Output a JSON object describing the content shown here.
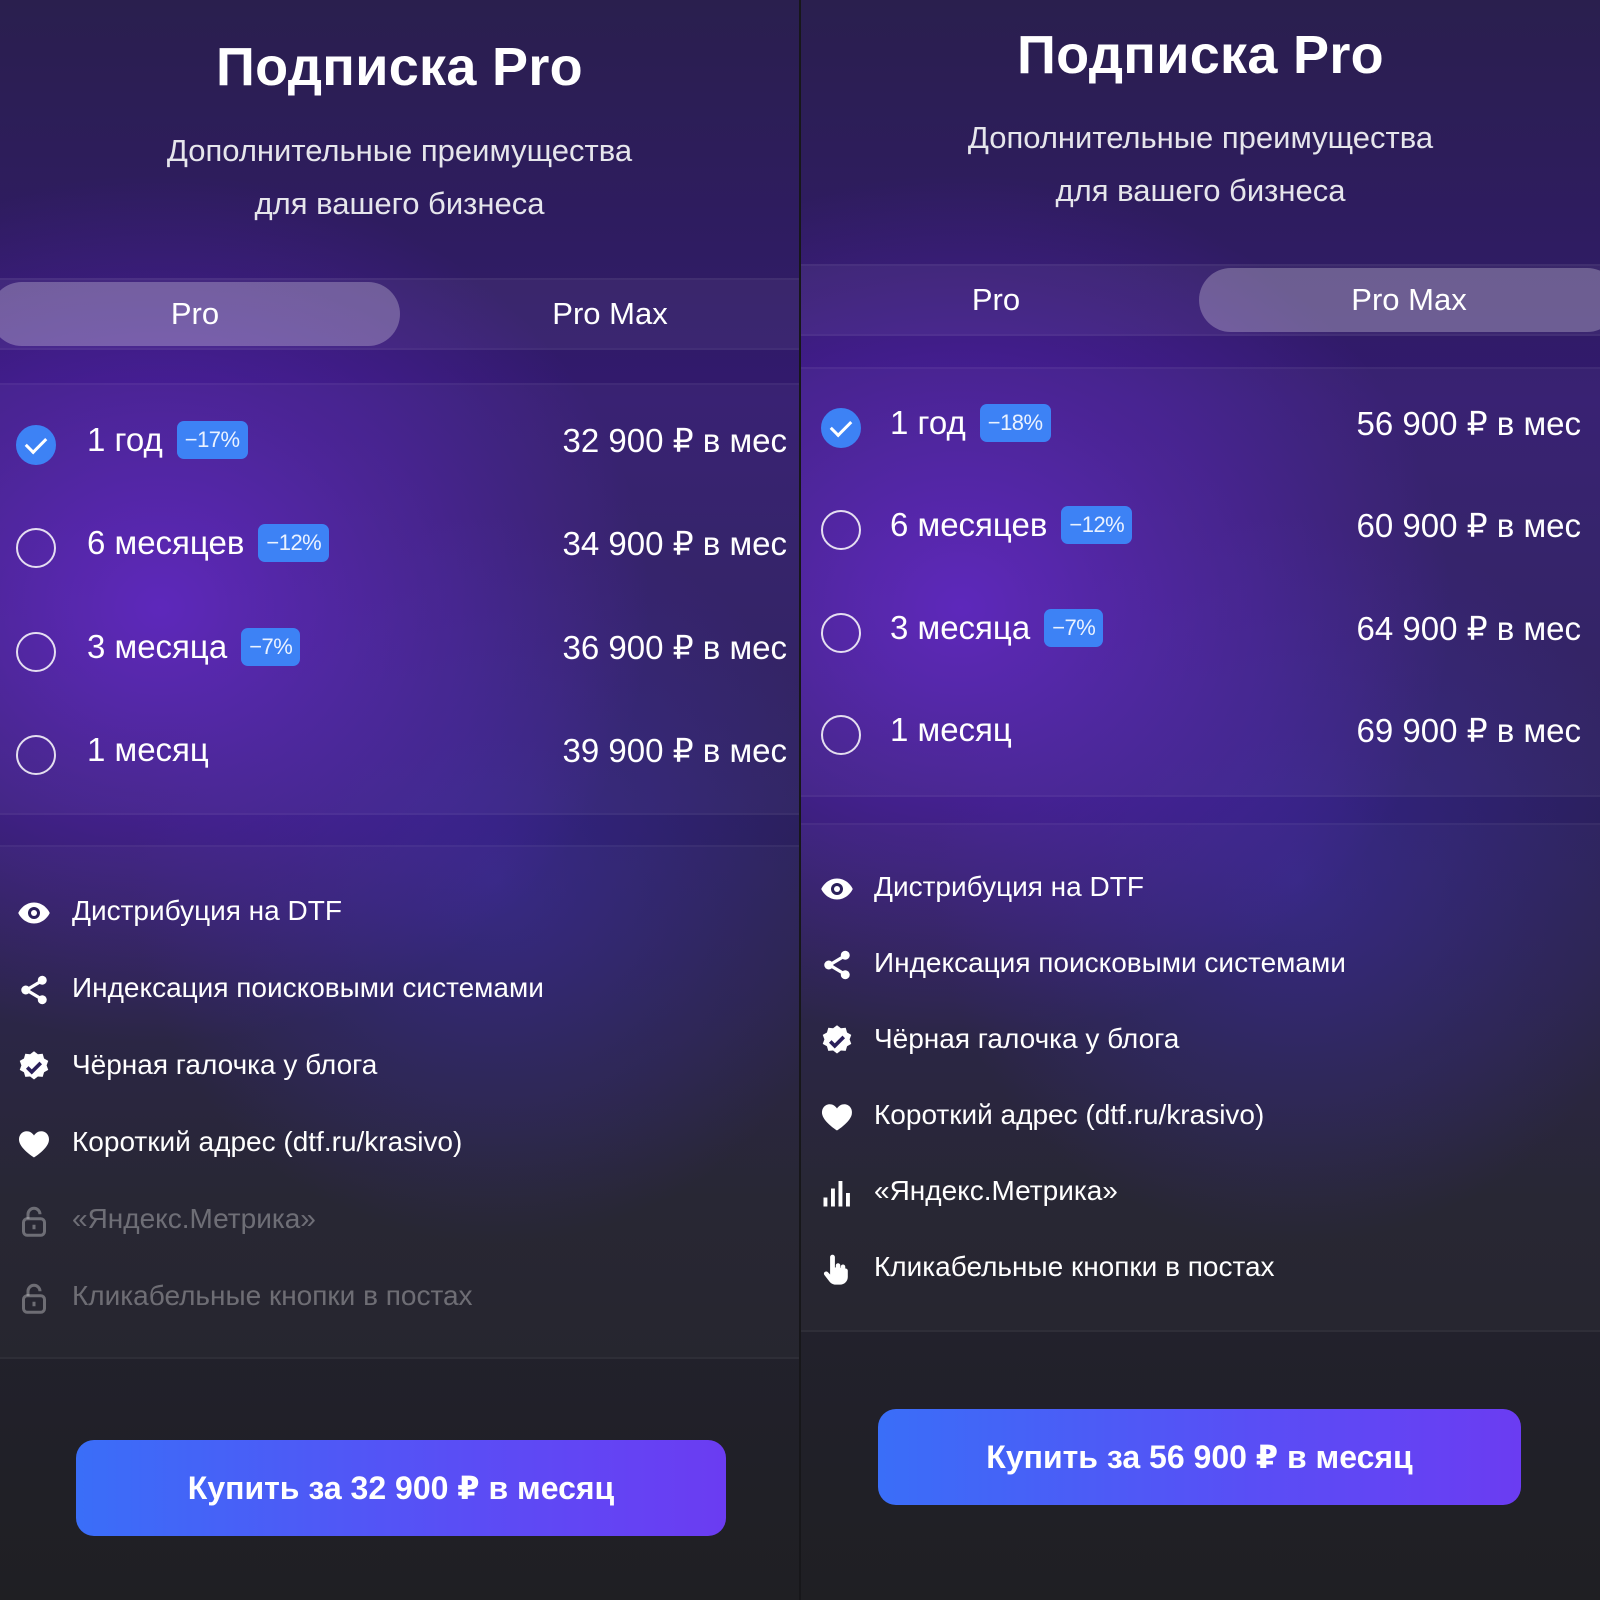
{
  "screens": [
    {
      "title": "Подписка Pro",
      "subtitle_line1": "Дополнительные преимущества",
      "subtitle_line2": "для вашего бизнеса",
      "tabs": [
        {
          "label": "Pro",
          "active": true
        },
        {
          "label": "Pro Max",
          "active": false
        }
      ],
      "plans": [
        {
          "label": "1 год",
          "badge": "−17%",
          "price": "32 900 ₽ в мес",
          "selected": true
        },
        {
          "label": "6 месяцев",
          "badge": "−12%",
          "price": "34 900 ₽ в мес",
          "selected": false
        },
        {
          "label": "3 месяца",
          "badge": "−7%",
          "price": "36 900 ₽ в мес",
          "selected": false
        },
        {
          "label": "1 месяц",
          "badge": "",
          "price": "39 900 ₽ в мес",
          "selected": false
        }
      ],
      "features": [
        {
          "text": "Дистрибуция на DTF",
          "icon": "eye-icon",
          "locked": false
        },
        {
          "text": "Индексация поисковыми системами",
          "icon": "share-icon",
          "locked": false
        },
        {
          "text": "Чёрная галочка у блога",
          "icon": "verified-icon",
          "locked": false
        },
        {
          "text": "Короткий адрес (dtf.ru/krasivo)",
          "icon": "heart-icon",
          "locked": false
        },
        {
          "text": "«Яндекс.Метрика»",
          "icon": "lock-icon",
          "locked": true
        },
        {
          "text": "Кликабельные кнопки в постах",
          "icon": "lock-icon",
          "locked": true
        }
      ],
      "buy_label": "Купить за 32 900 ₽ в месяц"
    },
    {
      "title": "Подписка Pro",
      "subtitle_line1": "Дополнительные преимущества",
      "subtitle_line2": "для вашего бизнеса",
      "tabs": [
        {
          "label": "Pro",
          "active": false
        },
        {
          "label": "Pro Max",
          "active": true
        }
      ],
      "plans": [
        {
          "label": "1 год",
          "badge": "−18%",
          "price": "56 900 ₽ в мес",
          "selected": true
        },
        {
          "label": "6 месяцев",
          "badge": "−12%",
          "price": "60 900 ₽ в мес",
          "selected": false
        },
        {
          "label": "3 месяца",
          "badge": "−7%",
          "price": "64 900 ₽ в мес",
          "selected": false
        },
        {
          "label": "1 месяц",
          "badge": "",
          "price": "69 900 ₽ в мес",
          "selected": false
        }
      ],
      "features": [
        {
          "text": "Дистрибуция на DTF",
          "icon": "eye-icon",
          "locked": false
        },
        {
          "text": "Индексация поисковыми системами",
          "icon": "share-icon",
          "locked": false
        },
        {
          "text": "Чёрная галочка у блога",
          "icon": "verified-icon",
          "locked": false
        },
        {
          "text": "Короткий адрес (dtf.ru/krasivo)",
          "icon": "heart-icon",
          "locked": false
        },
        {
          "text": "«Яндекс.Метрика»",
          "icon": "bar-chart-icon",
          "locked": false
        },
        {
          "text": "Кликабельные кнопки в постах",
          "icon": "pointer-hand-icon",
          "locked": false
        }
      ],
      "buy_label": "Купить за 56 900 ₽ в месяц"
    }
  ],
  "colors": {
    "accent": "#3d82f5",
    "button_start": "#3a6ef8",
    "button_end": "#6b3cf2"
  }
}
